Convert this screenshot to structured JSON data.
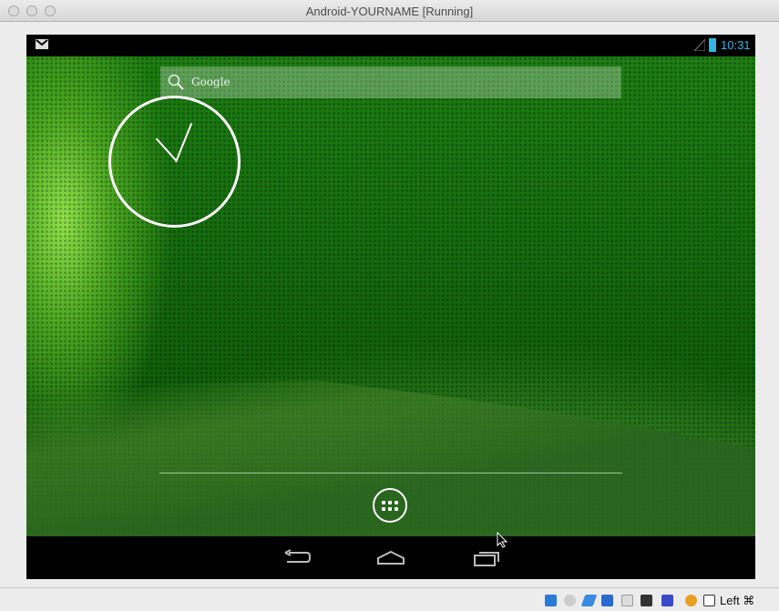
{
  "window": {
    "title": "Android-YOURNAME [Running]"
  },
  "statusbar": {
    "time": "10:31",
    "time_color": "#33b5e5",
    "notification_icon": "gmail-icon"
  },
  "search": {
    "placeholder": "Google"
  },
  "nav": {
    "back": "back-icon",
    "home": "home-icon",
    "recents": "recents-icon"
  },
  "vbox": {
    "host_key": "Left ⌘"
  }
}
